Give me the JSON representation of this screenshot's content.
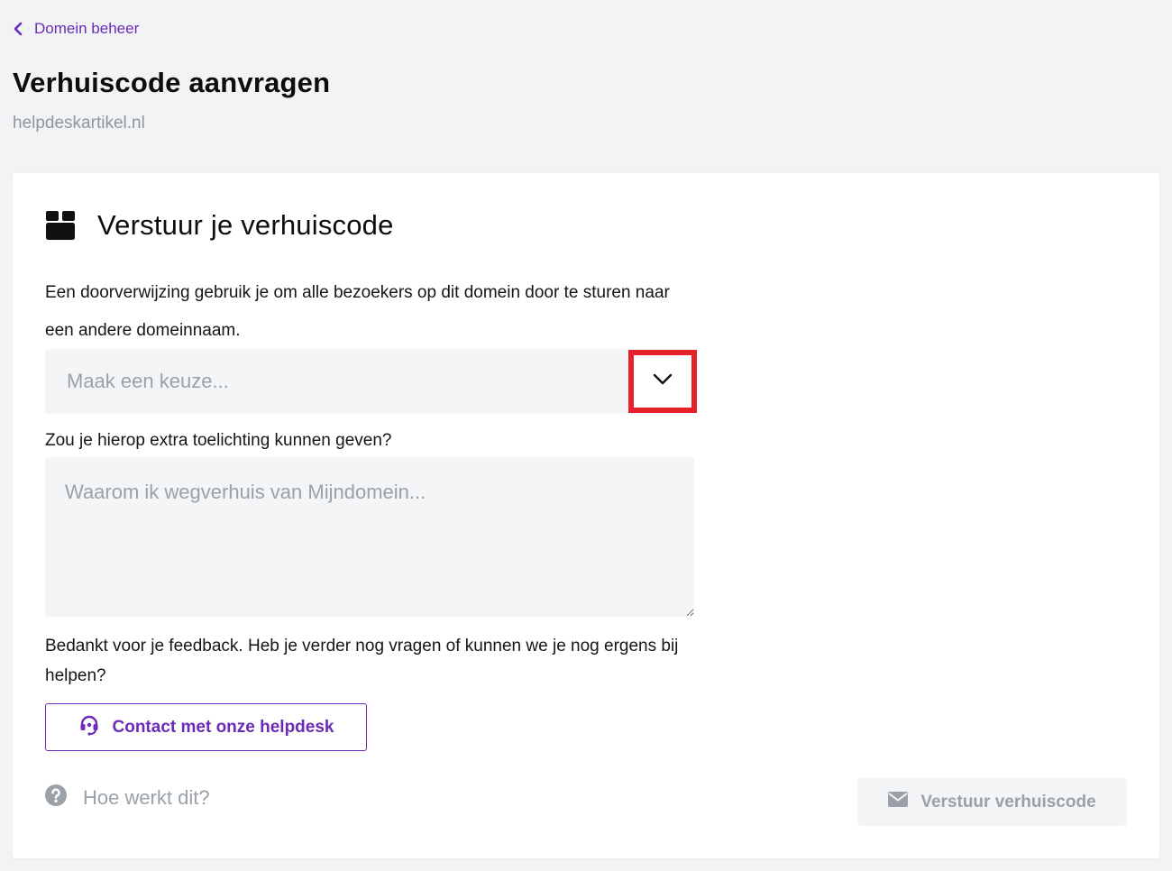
{
  "nav": {
    "back_label": "Domein beheer"
  },
  "header": {
    "title": "Verhuiscode aanvragen",
    "domain": "helpdeskartikel.nl"
  },
  "card": {
    "title": "Verstuur je verhuiscode",
    "intro": "Een doorverwijzing gebruik je om alle bezoekers op dit domein door te sturen naar een andere domeinnaam.",
    "select": {
      "placeholder": "Maak een keuze..."
    },
    "question_label": "Zou je hierop extra toelichting kunnen geven?",
    "textarea_placeholder": "Waarom ik wegverhuis van Mijndomein...",
    "thanks_text": "Bedankt voor je feedback. Heb je verder nog vragen of kunnen we je nog ergens bij helpen?",
    "helpdesk_button": "Contact met onze helpdesk",
    "how_link": "Hoe werkt dit?",
    "send_button": "Verstuur verhuiscode"
  },
  "colors": {
    "accent": "#6b2bb8",
    "highlight": "#e5212b",
    "muted": "#9aa1a8",
    "background": "#f2f3f5"
  },
  "icons": {
    "back": "chevron-left-icon",
    "card": "box-icon",
    "select": "chevron-down-icon",
    "helpdesk": "headset-icon",
    "how": "question-circle-icon",
    "send": "envelope-icon"
  }
}
